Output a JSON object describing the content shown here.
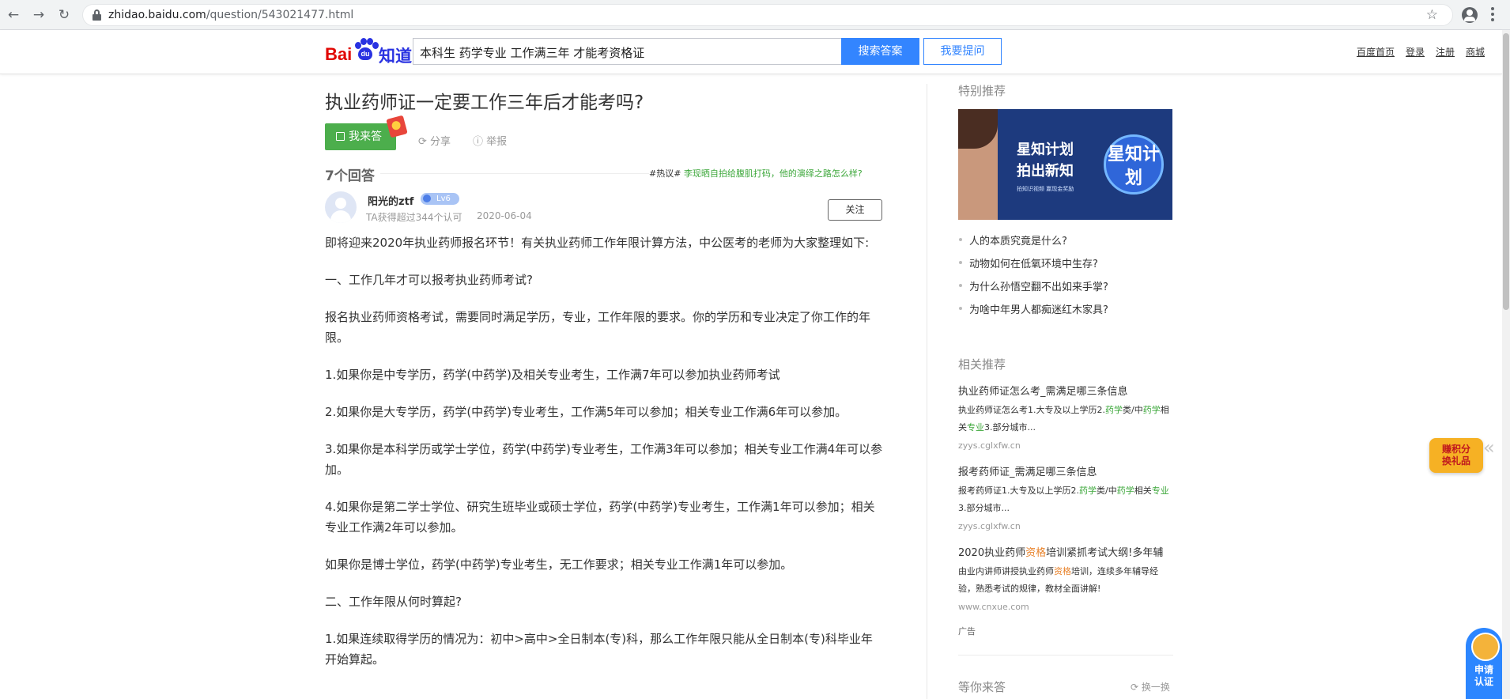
{
  "browser": {
    "url_host": "zhidao.baidu.com",
    "url_path": "/question/543021477.html"
  },
  "header": {
    "logo_text_bai": "Bai",
    "logo_text_du": "du",
    "logo_text_zhidao": "知道",
    "search_value": "本科生 药学专业 工作满三年 才能考资格证",
    "search_button": "搜索答案",
    "ask_button": "我要提问",
    "links": [
      "百度首页",
      "登录",
      "注册",
      "商城"
    ]
  },
  "question": {
    "title": "执业药师证一定要工作三年后才能考吗?",
    "answer_button": "我来答",
    "share": "分享",
    "report": "举报",
    "answer_count": "7个回答",
    "hot_tag": "#热议#",
    "hot_link": "李现晒自拍给腹肌打码，他的演绎之路怎么样?"
  },
  "answer": {
    "user_name": "阳光的ztf",
    "level": "Lv6",
    "meta": "TA获得超过344个认可",
    "date": "2020-06-04",
    "follow": "关注",
    "paragraphs": [
      "即将迎来2020年执业药师报名环节！有关执业药师工作年限计算方法，中公医考的老师为大家整理如下:",
      "一、工作几年才可以报考执业药师考试?",
      "报名执业药师资格考试，需要同时满足学历，专业，工作年限的要求。你的学历和专业决定了你工作的年限。",
      "1.如果你是中专学历，药学(中药学)及相关专业考生，工作满7年可以参加执业药师考试",
      "2.如果你是大专学历，药学(中药学)专业考生，工作满5年可以参加；相关专业工作满6年可以参加。",
      "3.如果你是本科学历或学士学位，药学(中药学)专业考生，工作满3年可以参加；相关专业工作满4年可以参加。",
      "4.如果你是第二学士学位、研究生班毕业或硕士学位，药学(中药学)专业考生，工作满1年可以参加；相关专业工作满2年可以参加。",
      "如果你是博士学位，药学(中药学)专业考生，无工作要求；相关专业工作满1年可以参加。",
      "二、工作年限从何时算起?",
      "1.如果连续取得学历的情况为：初中>高中>全日制本(专)科，那么工作年限只能从全日制本(专)科毕业年开始算起。"
    ]
  },
  "sidebar": {
    "special_heading": "特别推荐",
    "banner_line1": "星知计划",
    "banner_line2": "拍出新知",
    "banner_sub": "拍知识视频 赢现金奖励",
    "banner_logo": "星知计划",
    "bullets": [
      "人的本质究竟是什么?",
      "动物如何在低氧环境中生存?",
      "为什么孙悟空翻不出如来手掌?",
      "为啥中年男人都痴迷红木家具?"
    ],
    "related_heading": "相关推荐",
    "related": [
      {
        "title": "执业药师证怎么考_需满足哪三条信息",
        "desc_a": "执业药师证怎么考1.大专及以上学历2.",
        "desc_g1": "药学",
        "desc_b": "类/中",
        "desc_g2": "药学",
        "desc_c": "相关",
        "desc_g3": "专业",
        "desc_d": "3.部分城市...",
        "url": "zyys.cglxfw.cn"
      },
      {
        "title": "报考药师证_需满足哪三条信息",
        "desc_a": "报考药师证1.大专及以上学历2.",
        "desc_g1": "药学",
        "desc_b": "类/中",
        "desc_g2": "药学",
        "desc_c": "相关",
        "desc_g3": "专业",
        "desc_d": "3.部分城市...",
        "url": "zyys.cglxfw.cn"
      }
    ],
    "ad_item": {
      "title_a": "2020执业药师",
      "title_o": "资格",
      "title_b": "培训紧抓考试大纲!多年辅",
      "desc_a": "由业内讲师讲授执业药师",
      "desc_o": "资格",
      "desc_b": "培训，连续多年辅导经验，熟悉考试的规律，教材全面讲解!",
      "url": "www.cnxue.com"
    },
    "ad_label": "广告",
    "waiting_heading": "等你来答",
    "swap": "换一换"
  },
  "floating": {
    "gift_line1": "赚积分",
    "gift_line2": "换礼品",
    "certify_line1": "申请",
    "certify_line2": "认证"
  }
}
